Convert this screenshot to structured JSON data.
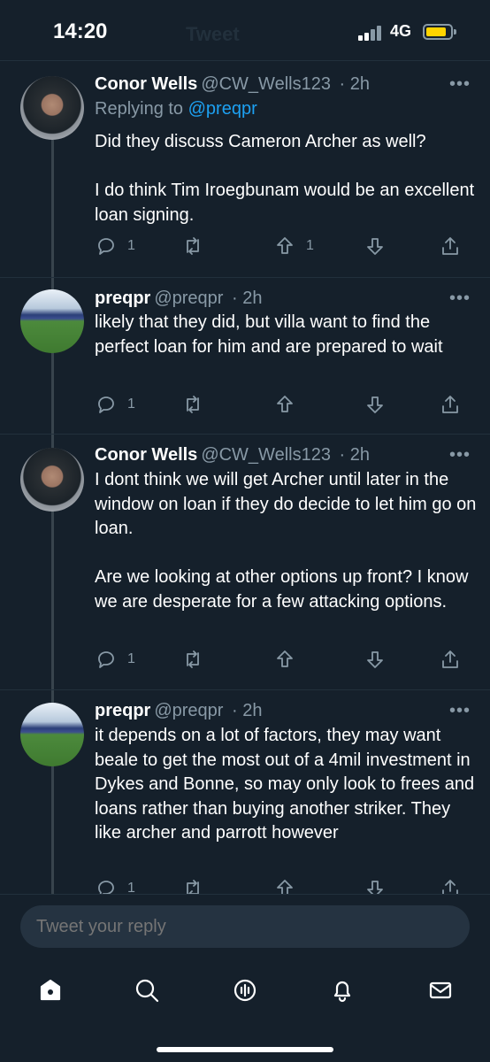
{
  "status": {
    "time": "14:20",
    "network": "4G",
    "ghost_title": "Tweet"
  },
  "tweets": [
    {
      "name": "Conor Wells",
      "handle": "@CW_Wells123",
      "time": "· 2h",
      "replying_prefix": "Replying to",
      "replying_to": "@preqpr",
      "body": "Did they discuss Cameron Archer as well?\n\nI do think Tim Iroegbunam would be an excellent loan signing.",
      "reply_count": "1",
      "retweet_count": "",
      "upvote_count": "1",
      "more": "•••"
    },
    {
      "name": "preqpr",
      "handle": "@preqpr",
      "time": "· 2h",
      "body": "likely that they did, but villa want to find the perfect loan for him and are prepared to wait",
      "reply_count": "1",
      "retweet_count": "",
      "upvote_count": "",
      "more": "•••"
    },
    {
      "name": "Conor Wells",
      "handle": "@CW_Wells123",
      "time": "· 2h",
      "body": "I dont think we will get Archer until later in the window on loan if they do decide to let him go on loan.\n\nAre we looking at other options up front? I know we are desperate for a few attacking options.",
      "reply_count": "1",
      "retweet_count": "",
      "upvote_count": "",
      "more": "•••"
    },
    {
      "name": "preqpr",
      "handle": "@preqpr",
      "time": "· 2h",
      "body": "it depends on a lot of factors, they may want beale to get the most out of a 4mil investment in Dykes and Bonne, so may only look to frees and loans rather than buying another striker. They like archer and parrott however",
      "reply_count": "1",
      "retweet_count": "",
      "upvote_count": "",
      "more": "•••"
    }
  ],
  "reply": {
    "placeholder": "Tweet your reply"
  },
  "tabs": [
    "home-icon",
    "search-icon",
    "spaces-icon",
    "notifications-icon",
    "messages-icon"
  ]
}
